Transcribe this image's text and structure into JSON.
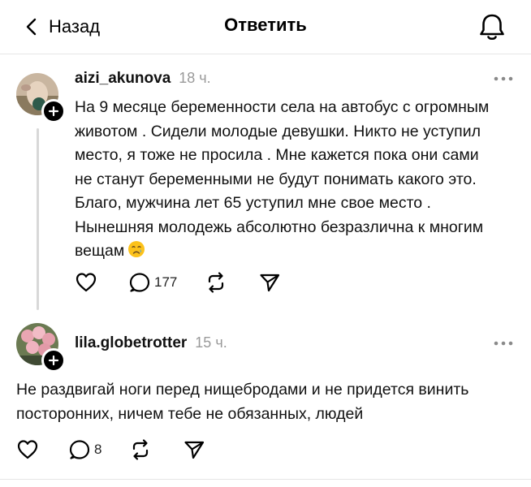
{
  "header": {
    "back_label": "Назад",
    "title": "Ответить"
  },
  "posts": [
    {
      "username": "aizi_akunova",
      "time": "18 ч.",
      "text": "На 9 месяце беременности села на автобус с огромным животом . Сидели молодые девушки. Никто не уступил место, я тоже не просила . Мне кажется пока они сами не станут беременными не будут понимать какого это. Благо, мужчина  лет 65 уступил мне свое место . Нынешняя молодежь абсолютно безразлична к многим вещам",
      "emoji": "crying-face",
      "reply_count": "177"
    },
    {
      "username": "lila.globetrotter",
      "time": "15 ч.",
      "text": "Не раздвигай ноги перед нищебродами и не придется винить посторонних, ничем тебе не обязанных, людей",
      "reply_count": "8"
    }
  ],
  "icons": {
    "back": "chevron-left-icon",
    "notifications": "bell-icon",
    "more": "ellipsis-icon",
    "like": "heart-icon",
    "reply": "speech-bubble-icon",
    "repost": "repost-icon",
    "share": "send-icon",
    "follow": "plus-icon"
  }
}
